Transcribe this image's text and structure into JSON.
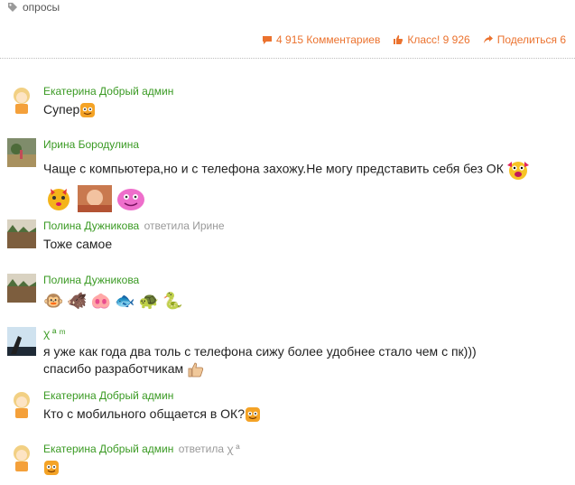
{
  "tags": {
    "label": "опросы"
  },
  "stats": {
    "comments": "4 915 Комментариев",
    "likes": "Класс! 9 926",
    "shares": "Поделиться 6"
  },
  "comments": [
    {
      "author": "Екатерина Добрый админ",
      "text": "Супер"
    },
    {
      "author": "Ирина Бородулина",
      "text": "Чаще с компьютера,но и с телефона захожу.Не могу представить себя без ОК"
    },
    {
      "author": "Полина Дужникова",
      "reply": "ответила Ирине",
      "text": "Тоже самое"
    },
    {
      "author": "Полина Дужникова",
      "emojis": [
        "🐵",
        "🐗",
        "🐽",
        "🐟",
        "🐢",
        "🐍"
      ]
    },
    {
      "author": "ꭓ ª ᵐ",
      "text": "я уже как года два толь с телефона сижу более удобнее стало чем с пк))) спасибо разработчикам"
    },
    {
      "author": "Екатерина Добрый админ",
      "text": "Кто с мобильного общается в ОК?"
    },
    {
      "author": "Екатерина Добрый админ",
      "reply": "ответила ꭓ ª"
    }
  ]
}
